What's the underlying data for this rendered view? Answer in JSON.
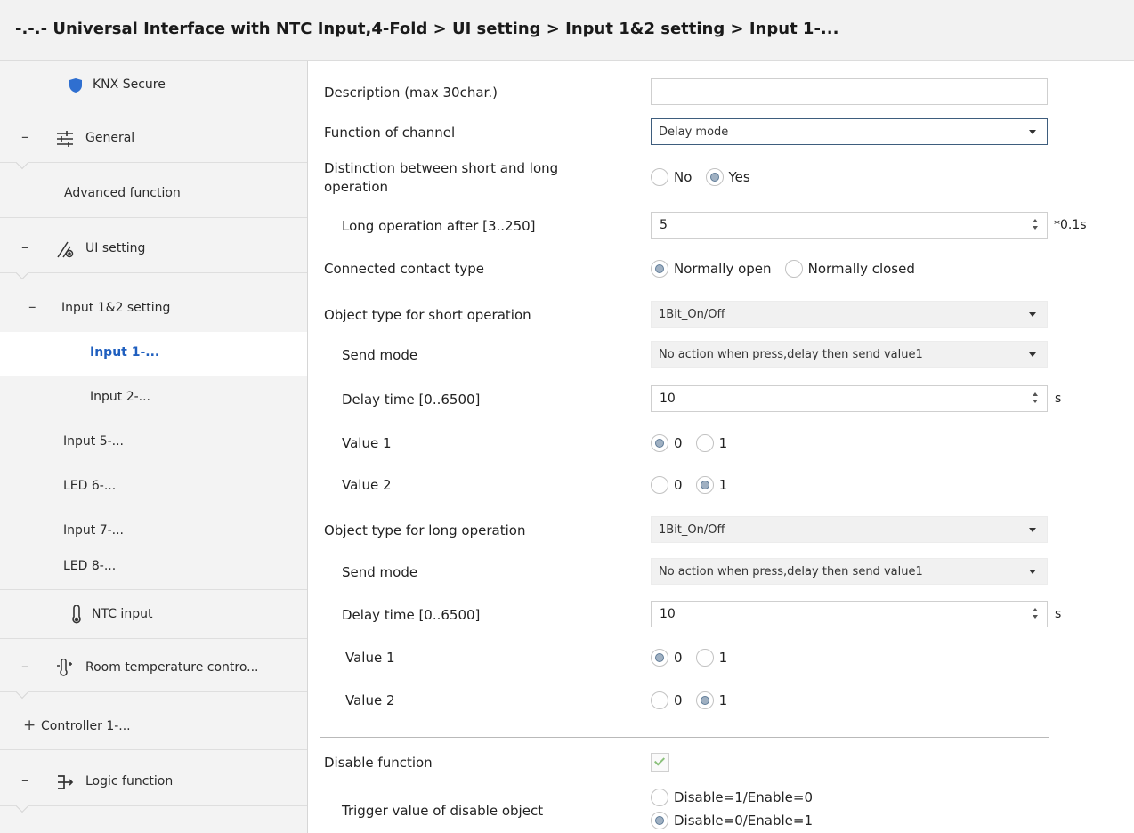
{
  "header": {
    "title": "-.-.- Universal Interface with NTC Input,4-Fold > UI setting > Input 1&2 setting > Input 1-..."
  },
  "sidebar": {
    "items": [
      {
        "label": "KNX Secure",
        "expander": "",
        "icon": "shield-icon"
      },
      {
        "label": "General",
        "expander": "–",
        "icon": "sliders-icon"
      },
      {
        "label": "Advanced function",
        "expander": "",
        "icon": ""
      },
      {
        "label": "UI setting",
        "expander": "–",
        "icon": "ui-setting-icon"
      },
      {
        "label": "Input 1&2 setting",
        "expander": "–",
        "icon": ""
      },
      {
        "label": "Input 1-...",
        "expander": "",
        "icon": ""
      },
      {
        "label": "Input 2-...",
        "expander": "",
        "icon": ""
      },
      {
        "label": "Input 5-...",
        "expander": "",
        "icon": ""
      },
      {
        "label": "LED 6-...",
        "expander": "",
        "icon": ""
      },
      {
        "label": "Input 7-...",
        "expander": "",
        "icon": ""
      },
      {
        "label": "LED 8-...",
        "expander": "",
        "icon": ""
      },
      {
        "label": "NTC input",
        "expander": "",
        "icon": "thermometer-icon"
      },
      {
        "label": "Room temperature contro...",
        "expander": "–",
        "icon": "thermostat-icon"
      },
      {
        "label": "Controller 1-...",
        "expander": "+",
        "icon": ""
      },
      {
        "label": "Logic function",
        "expander": "–",
        "icon": "logic-icon"
      }
    ]
  },
  "params": {
    "description": {
      "label": "Description (max 30char.)",
      "value": ""
    },
    "function_of_channel": {
      "label": "Function of channel",
      "value": "Delay mode"
    },
    "distinction": {
      "label_line1": "Distinction between short and long",
      "label_line2": "operation",
      "options": [
        "No",
        "Yes"
      ],
      "selected": "Yes"
    },
    "long_operation_after": {
      "label": "Long operation after [3..250]",
      "value": "5",
      "unit": "*0.1s"
    },
    "connected_contact_type": {
      "label": "Connected contact type",
      "options": [
        "Normally open",
        "Normally closed"
      ],
      "selected": "Normally open"
    },
    "short_object_type": {
      "label": "Object type for short operation",
      "value": "1Bit_On/Off"
    },
    "short_send_mode": {
      "label": "Send mode",
      "value": "No action when press,delay then send value1"
    },
    "short_delay_time": {
      "label": "Delay time [0..6500]",
      "value": "10",
      "unit": "s"
    },
    "short_value1": {
      "label": "Value 1",
      "options": [
        "0",
        "1"
      ],
      "selected": "0"
    },
    "short_value2": {
      "label": "Value 2",
      "options": [
        "0",
        "1"
      ],
      "selected": "1"
    },
    "long_object_type": {
      "label": "Object type for long operation",
      "value": "1Bit_On/Off"
    },
    "long_send_mode": {
      "label": "Send mode",
      "value": "No action when press,delay then send value1"
    },
    "long_delay_time": {
      "label": "Delay time [0..6500]",
      "value": "10",
      "unit": "s"
    },
    "long_value1": {
      "label": "Value 1",
      "options": [
        "0",
        "1"
      ],
      "selected": "0"
    },
    "long_value2": {
      "label": "Value 2",
      "options": [
        "0",
        "1"
      ],
      "selected": "1"
    },
    "disable_function": {
      "label": "Disable function",
      "checked": true
    },
    "trigger_value": {
      "label": "Trigger value of disable object",
      "options": [
        "Disable=1/Enable=0",
        "Disable=0/Enable=1"
      ],
      "selected": "Disable=0/Enable=1"
    }
  }
}
